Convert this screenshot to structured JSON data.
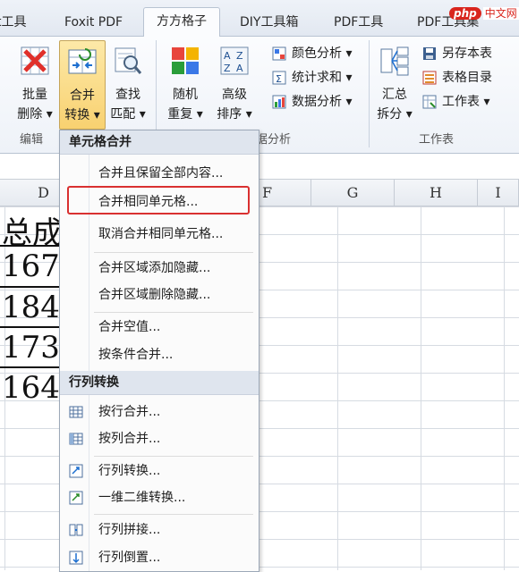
{
  "tabs": [
    {
      "label": "t工具",
      "active": false
    },
    {
      "label": "Foxit PDF",
      "active": false
    },
    {
      "label": "方方格子",
      "active": true
    },
    {
      "label": "DIY工具箱",
      "active": false
    },
    {
      "label": "PDF工具",
      "active": false
    },
    {
      "label": "PDF工具集",
      "active": false
    }
  ],
  "watermark": {
    "text": "php",
    "sub": "中文网"
  },
  "ribbon": {
    "batch_delete": {
      "l1": "批量",
      "l2": "删除 ▾"
    },
    "merge_convert": {
      "l1": "合并",
      "l2": "转换 ▾"
    },
    "find_match": {
      "l1": "查找",
      "l2": "匹配 ▾"
    },
    "random_repeat": {
      "l1": "随机",
      "l2": "重复 ▾"
    },
    "advanced_sort": {
      "l1": "高级",
      "l2": "排序 ▾"
    },
    "color_analysis": "颜色分析 ▾",
    "stats_sum": "统计求和 ▾",
    "data_analysis": "数据分析 ▾",
    "summary_split": {
      "l1": "汇总",
      "l2": "拆分 ▾"
    },
    "save_sheet": "另存本表",
    "table_toc": "表格目录",
    "worksheet": "工作表 ▾",
    "groups": {
      "edit": "编辑",
      "analysis": "据分析",
      "worksheet": "工作表"
    }
  },
  "columns": [
    "D",
    "F",
    "G",
    "H",
    "I"
  ],
  "cells": [
    "总成",
    "167",
    "184",
    "173",
    "164"
  ],
  "menu": {
    "section1": "单元格合并",
    "items1": [
      "合并且保留全部内容...",
      "合并相同单元格...",
      "取消合并相同单元格...",
      "合并区域添加隐藏...",
      "合并区域删除隐藏...",
      "合并空值...",
      "按条件合并..."
    ],
    "section2": "行列转换",
    "items2": [
      "按行合并...",
      "按列合并...",
      "行列转换...",
      "一维二维转换...",
      "行列拼接...",
      "行列倒置..."
    ]
  }
}
